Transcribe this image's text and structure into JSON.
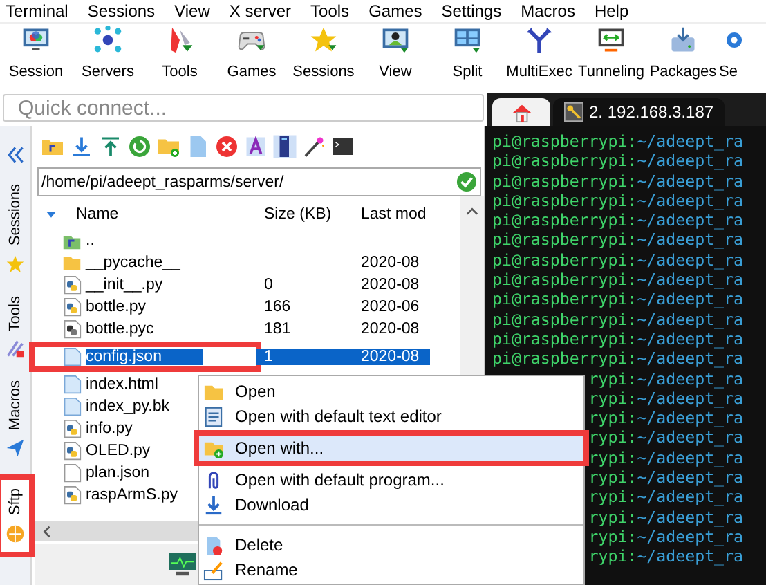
{
  "menu_bar": [
    "Terminal",
    "Sessions",
    "View",
    "X server",
    "Tools",
    "Games",
    "Settings",
    "Macros",
    "Help"
  ],
  "toolbar": [
    "Session",
    "Servers",
    "Tools",
    "Games",
    "Sessions",
    "View",
    "Split",
    "MultiExec",
    "Tunneling",
    "Packages",
    "Se"
  ],
  "quick_connect": {
    "placeholder": "Quick connect..."
  },
  "tabs": [
    {
      "kind": "home",
      "selected": false
    },
    {
      "kind": "session",
      "label": "2. 192.168.3.187",
      "selected": true
    }
  ],
  "side_tabs": [
    {
      "label": "Sessions",
      "selected": false,
      "boxed": false
    },
    {
      "label": "Tools",
      "selected": false,
      "boxed": false
    },
    {
      "label": "Macros",
      "selected": false,
      "boxed": false
    },
    {
      "label": "Sftp",
      "selected": true,
      "boxed": true
    }
  ],
  "sftp": {
    "path": "/home/pi/adeept_rasparms/server/",
    "columns": [
      "Name",
      "Size (KB)",
      "Last mod"
    ],
    "rows": [
      {
        "kind": "up",
        "name": "..",
        "selected": false
      },
      {
        "kind": "folder",
        "name": "__pycache__",
        "date": "2020-08",
        "selected": false
      },
      {
        "kind": "python",
        "name": "__init__.py",
        "size": "0",
        "date": "2020-08",
        "selected": false
      },
      {
        "kind": "python",
        "name": "bottle.py",
        "size": "166",
        "date": "2020-06",
        "selected": false
      },
      {
        "kind": "compiled",
        "name": "bottle.pyc",
        "size": "181",
        "date": "2020-08",
        "selected": false
      },
      {
        "kind": "file",
        "name": "config.json",
        "size": "1",
        "date": "2020-08",
        "selected": true,
        "boxed": true
      },
      {
        "kind": "file",
        "name": "index.html",
        "selected": false
      },
      {
        "kind": "file",
        "name": "index_py.bk",
        "selected": false
      },
      {
        "kind": "python",
        "name": "info.py",
        "selected": false
      },
      {
        "kind": "python",
        "name": "OLED.py",
        "selected": false
      },
      {
        "kind": "plain",
        "name": "plan.json",
        "selected": false
      },
      {
        "kind": "python",
        "name": "raspArmS.py",
        "selected": false
      }
    ]
  },
  "context_menu": [
    {
      "kind": "item",
      "label": "Open",
      "selected": false
    },
    {
      "kind": "item",
      "label": "Open with default text editor",
      "selected": false
    },
    {
      "kind": "item",
      "label": "Open with...",
      "selected": true,
      "boxed": true
    },
    {
      "kind": "item",
      "label": "Open with default program...",
      "selected": false
    },
    {
      "kind": "item",
      "label": "Download",
      "selected": false
    },
    {
      "kind": "separator"
    },
    {
      "kind": "item",
      "label": "Delete",
      "selected": false
    },
    {
      "kind": "item",
      "label": "Rename",
      "selected": false
    }
  ],
  "terminal": {
    "lines": [
      {
        "kind": "full",
        "user": "pi@raspberrypi:",
        "path": "~/adeept_ra"
      },
      {
        "kind": "full",
        "user": "pi@raspberrypi:",
        "path": "~/adeept_ra"
      },
      {
        "kind": "full",
        "user": "pi@raspberrypi:",
        "path": "~/adeept_ra"
      },
      {
        "kind": "full",
        "user": "pi@raspberrypi:",
        "path": "~/adeept_ra"
      },
      {
        "kind": "full",
        "user": "pi@raspberrypi:",
        "path": "~/adeept_ra"
      },
      {
        "kind": "full",
        "user": "pi@raspberrypi:",
        "path": "~/adeept_ra"
      },
      {
        "kind": "full",
        "user": "pi@raspberrypi:",
        "path": "~/adeept_ra"
      },
      {
        "kind": "full",
        "user": "pi@raspberrypi:",
        "path": "~/adeept_ra"
      },
      {
        "kind": "full",
        "user": "pi@raspberrypi:",
        "path": "~/adeept_ra"
      },
      {
        "kind": "full",
        "user": "pi@raspberrypi:",
        "path": "~/adeept_ra"
      },
      {
        "kind": "full",
        "user": "pi@raspberrypi:",
        "path": "~/adeept_ra"
      },
      {
        "kind": "full",
        "user": "pi@raspberrypi:",
        "path": "~/adeept_ra"
      },
      {
        "kind": "partial",
        "user": "rypi:",
        "path": "~/adeept_ra"
      },
      {
        "kind": "partial",
        "user": "rypi:",
        "path": "~/adeept_ra"
      },
      {
        "kind": "partial",
        "user": "rypi:",
        "path": "~/adeept_ra"
      },
      {
        "kind": "partial",
        "user": "rypi:",
        "path": "~/adeept_ra"
      },
      {
        "kind": "partial",
        "user": "rypi:",
        "path": "~/adeept_ra"
      },
      {
        "kind": "partial",
        "user": "rypi:",
        "path": "~/adeept_ra"
      },
      {
        "kind": "partial",
        "user": "rypi:",
        "path": "~/adeept_ra"
      },
      {
        "kind": "partial",
        "user": "rypi:",
        "path": "~/adeept_ra"
      },
      {
        "kind": "partial",
        "user": "rypi:",
        "path": "~/adeept_ra"
      },
      {
        "kind": "partial",
        "user": "rypi:",
        "path": "~/adeept_ra"
      }
    ]
  }
}
